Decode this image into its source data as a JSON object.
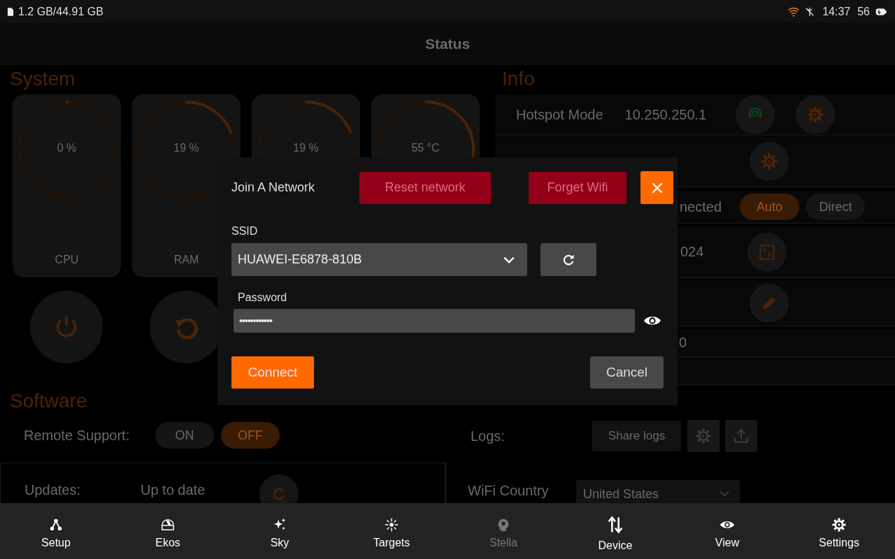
{
  "status_bar": {
    "storage": "1.2 GB/44.91 GB",
    "time": "14:37",
    "battery": "56"
  },
  "title": "Status",
  "system": {
    "title": "System",
    "gauges": [
      {
        "reading": "0 %",
        "label": "CPU",
        "level": 0
      },
      {
        "reading": "19 %",
        "label": "RAM",
        "level": 0.19
      },
      {
        "reading": "19 %",
        "level": 0.19
      },
      {
        "reading": "55 °C",
        "level": 0.27
      }
    ]
  },
  "info": {
    "title": "Info",
    "hotspot": {
      "label": "Hotspot Mode",
      "address": "10.250.250.1"
    },
    "connection": {
      "status": "nected",
      "options": [
        {
          "label": "Auto",
          "selected": true
        },
        {
          "label": "Direct",
          "selected": false
        }
      ]
    },
    "row_4": "024",
    "row_6": "0"
  },
  "software": {
    "title": "Software",
    "remote_support": {
      "label": "Remote Support:",
      "options": [
        {
          "label": "ON",
          "selected": false
        },
        {
          "label": "OFF",
          "selected": true
        }
      ]
    },
    "updates": {
      "label": "Updates:",
      "value": "Up to date"
    }
  },
  "logs": {
    "label": "Logs:",
    "button": "Share logs"
  },
  "wifi_country": {
    "label": "WiFi Country",
    "value": "United States"
  },
  "dialog": {
    "title": "Join A Network",
    "reset_button": "Reset network",
    "forget_button": "Forget Wifi",
    "ssid_label": "SSID",
    "ssid": "HUAWEI-E6878-810B",
    "password_label": "Password",
    "password": "••••••••••••",
    "connect_button": "Connect",
    "cancel_button": "Cancel"
  },
  "nav": [
    {
      "label": "Setup",
      "disabled": false
    },
    {
      "label": "Ekos",
      "disabled": false
    },
    {
      "label": "Sky",
      "disabled": false
    },
    {
      "label": "Targets",
      "disabled": false
    },
    {
      "label": "Stella",
      "disabled": true
    },
    {
      "label": "Device",
      "disabled": false
    },
    {
      "label": "View",
      "disabled": false
    },
    {
      "label": "Settings",
      "disabled": false
    }
  ]
}
